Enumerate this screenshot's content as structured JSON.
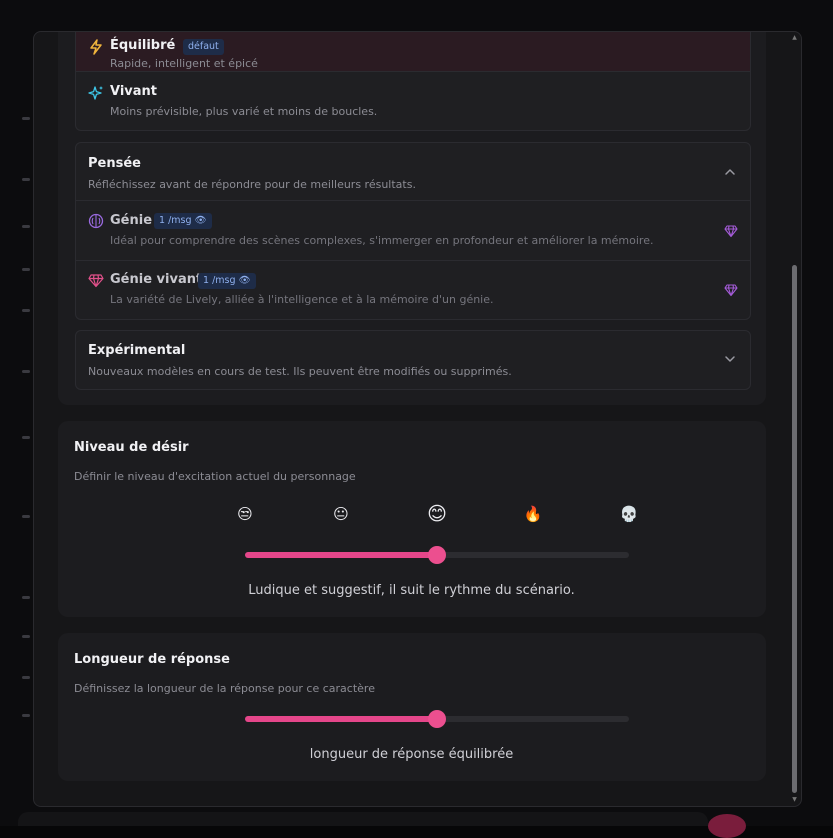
{
  "models": {
    "standard": {
      "items": [
        {
          "name": "Équilibré",
          "badge": "défaut",
          "desc": "Rapide, intelligent et épicé"
        },
        {
          "name": "Vivant",
          "desc": "Moins prévisible, plus varié et moins de boucles."
        }
      ]
    },
    "thinking": {
      "title": "Pensée",
      "desc": "Réfléchissez avant de répondre pour de meilleurs résultats.",
      "items": [
        {
          "name": "Génie",
          "cost": "1 /msg",
          "desc": "Idéal pour comprendre des scènes complexes, s'immerger en profondeur et améliorer la mémoire."
        },
        {
          "name": "Génie vivant",
          "cost": "1 /msg",
          "desc": "La variété de Lively, alliée à l'intelligence et à la mémoire d'un génie."
        }
      ]
    },
    "experimental": {
      "title": "Expérimental",
      "desc": "Nouveaux modèles en cours de test. Ils peuvent être modifiés ou supprimés."
    }
  },
  "desire": {
    "title": "Niveau de désir",
    "desc": "Définir le niveau d'excitation actuel du personnage",
    "levels": [
      "😒",
      "😐",
      "😊",
      "🔥",
      "💀"
    ],
    "selected_index": 2,
    "value_fraction": 0.5,
    "caption": "Ludique et suggestif, il suit le rythme du scénario."
  },
  "length": {
    "title": "Longueur de réponse",
    "desc": "Définissez la longueur de la réponse pour ce caractère",
    "value_fraction": 0.5,
    "caption": "longueur de réponse équilibrée"
  },
  "colors": {
    "accent": "#e5468a",
    "selected_row": "#2b1b22",
    "badge_bg": "#1e2c48",
    "gem": "#a45bd8"
  }
}
